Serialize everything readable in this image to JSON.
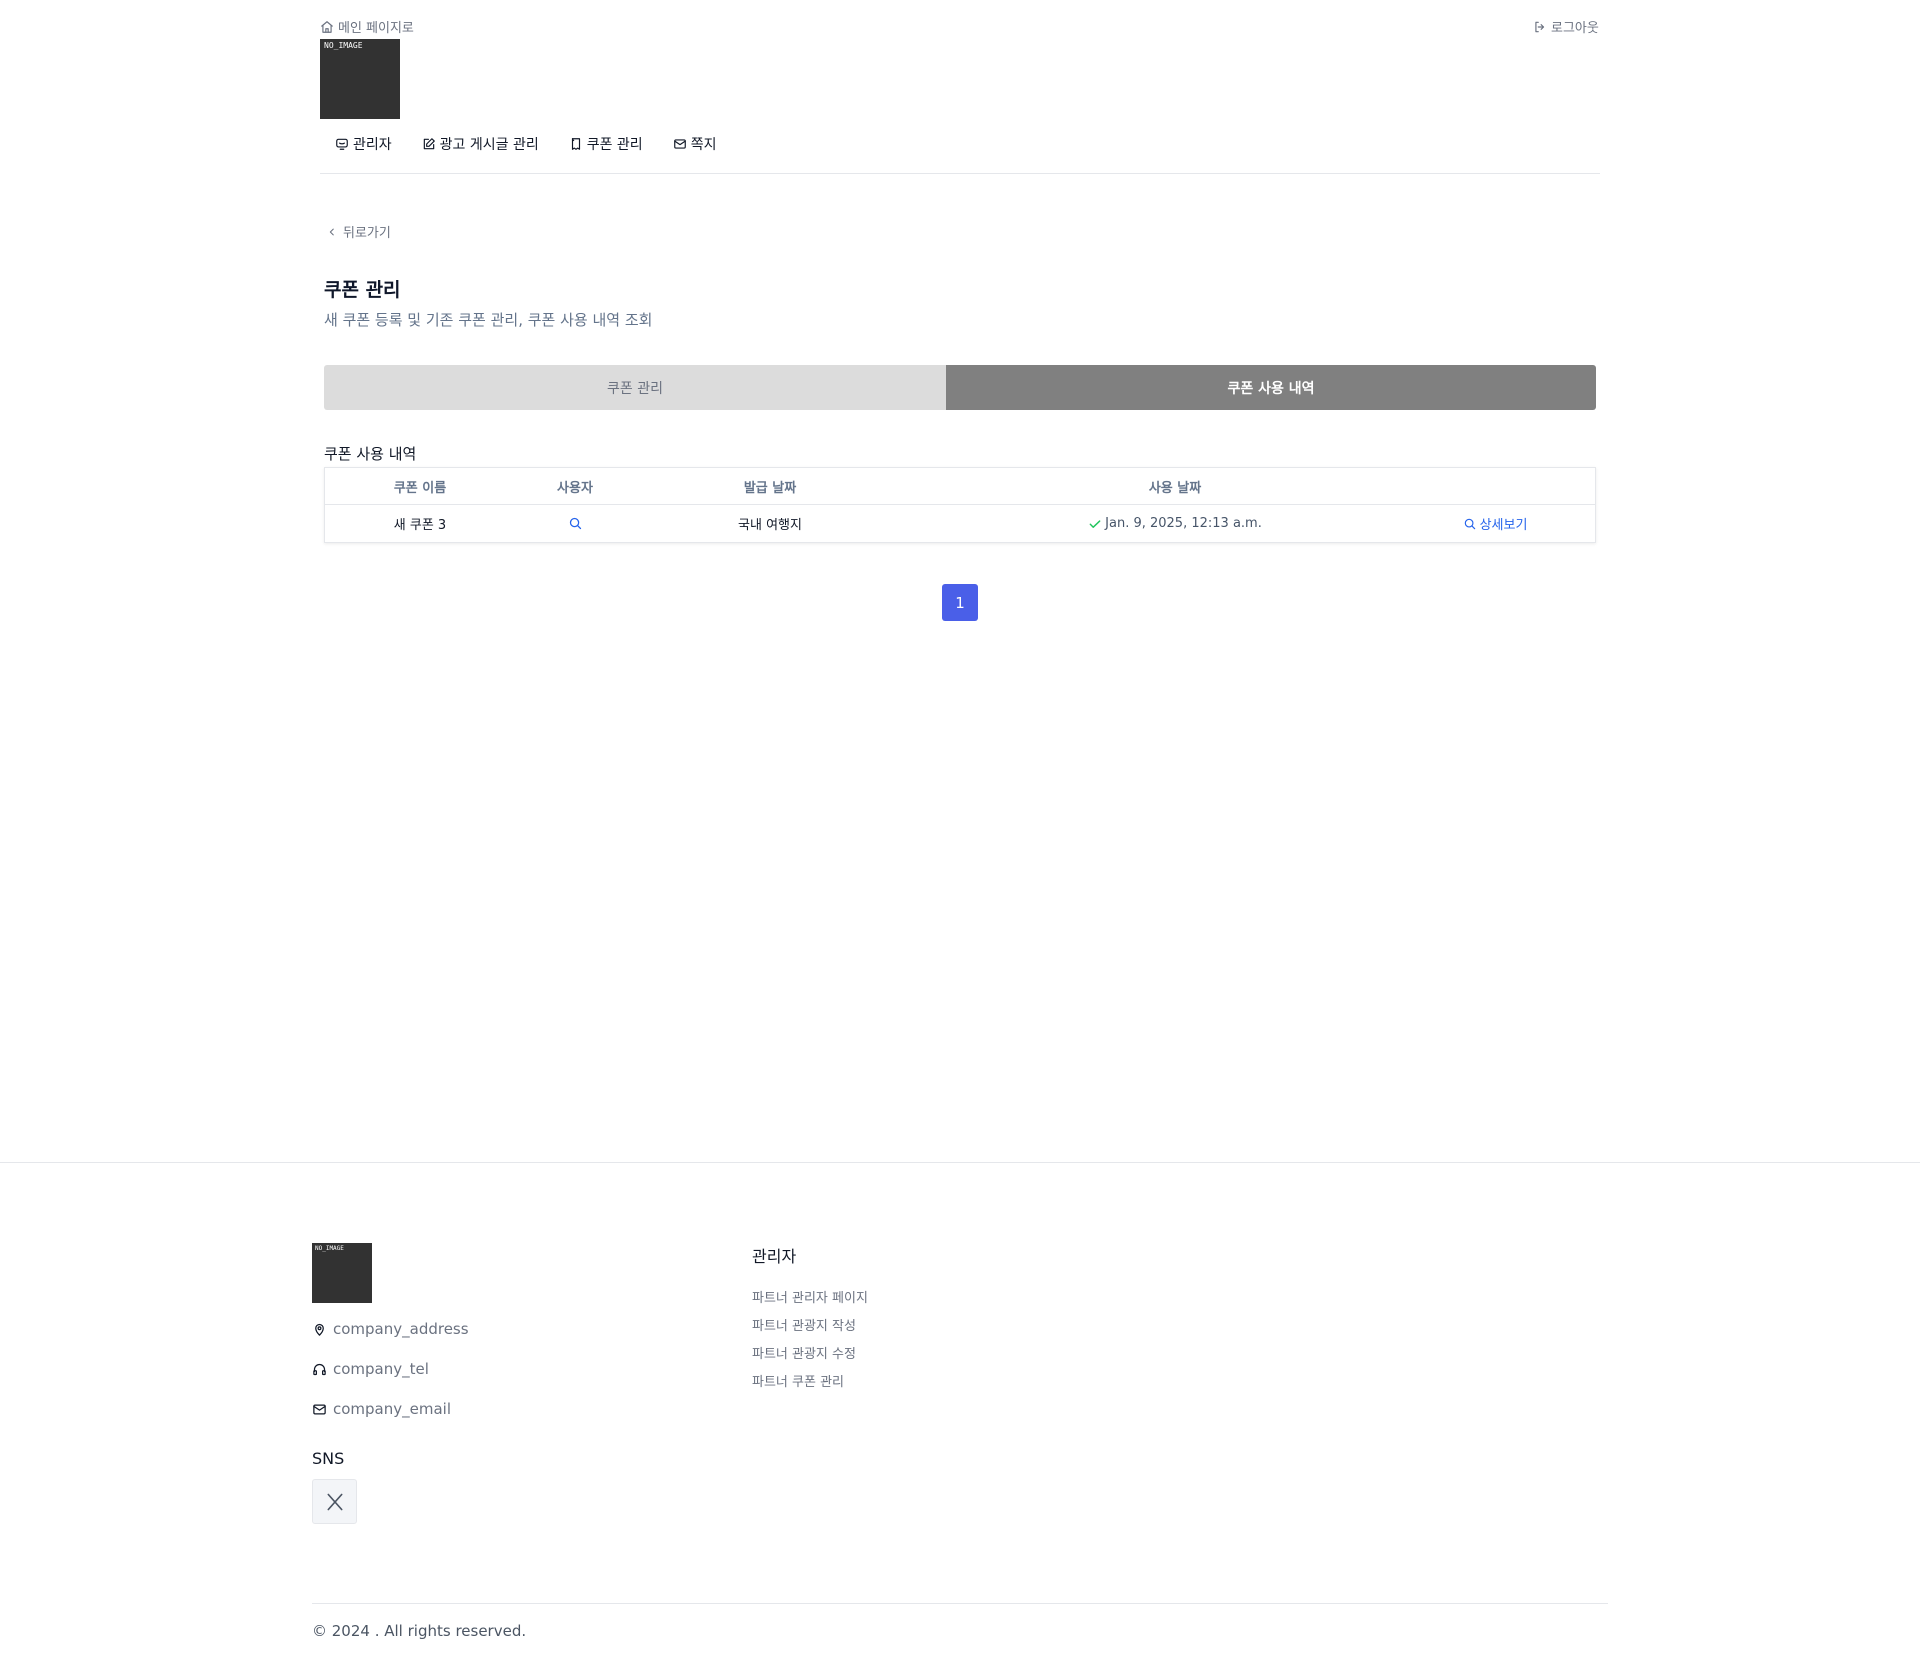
{
  "header": {
    "home_link": "메인 페이지로",
    "logout_link": "로그아웃",
    "logo_text": "NO_IMAGE",
    "nav": [
      {
        "label": "관리자",
        "icon": "admin-icon"
      },
      {
        "label": "광고 게시글 관리",
        "icon": "edit-icon"
      },
      {
        "label": "쿠폰 관리",
        "icon": "coupon-icon"
      },
      {
        "label": "쪽지",
        "icon": "mail-icon"
      }
    ]
  },
  "main": {
    "back_label": "뒤로가기",
    "title": "쿠폰 관리",
    "subtitle": "새 쿠폰 등록 및 기존 쿠폰 관리, 쿠폰 사용 내역 조회",
    "tabs": [
      {
        "label": "쿠폰 관리",
        "active": false
      },
      {
        "label": "쿠폰 사용 내역",
        "active": true
      }
    ],
    "section_title": "쿠폰 사용 내역",
    "table": {
      "headers": [
        "쿠폰 이름",
        "사용자",
        "발급 날짜",
        "사용 날짜"
      ],
      "rows": [
        {
          "coupon_name": "새 쿠폰 3",
          "issued": "국내 여행지",
          "used_date": "Jan. 9, 2025, 12:13 a.m.",
          "detail_label": "상세보기"
        }
      ]
    },
    "pagination": {
      "current": "1"
    }
  },
  "footer": {
    "logo_text": "NO_IMAGE",
    "address": "company_address",
    "tel": "company_tel",
    "email": "company_email",
    "sns_label": "SNS",
    "column_title": "관리자",
    "links": [
      "파트너 관리자 페이지",
      "파트너 관광지 작성",
      "파트너 관광지 수정",
      "파트너 쿠폰 관리"
    ],
    "copyright": "© 2024 . All rights reserved."
  },
  "colors": {
    "accent": "#4a5fe8",
    "active_tab": "#808080",
    "inactive_tab": "#dcdcdc",
    "link_blue": "#2563eb",
    "check_green": "#22c55e"
  }
}
